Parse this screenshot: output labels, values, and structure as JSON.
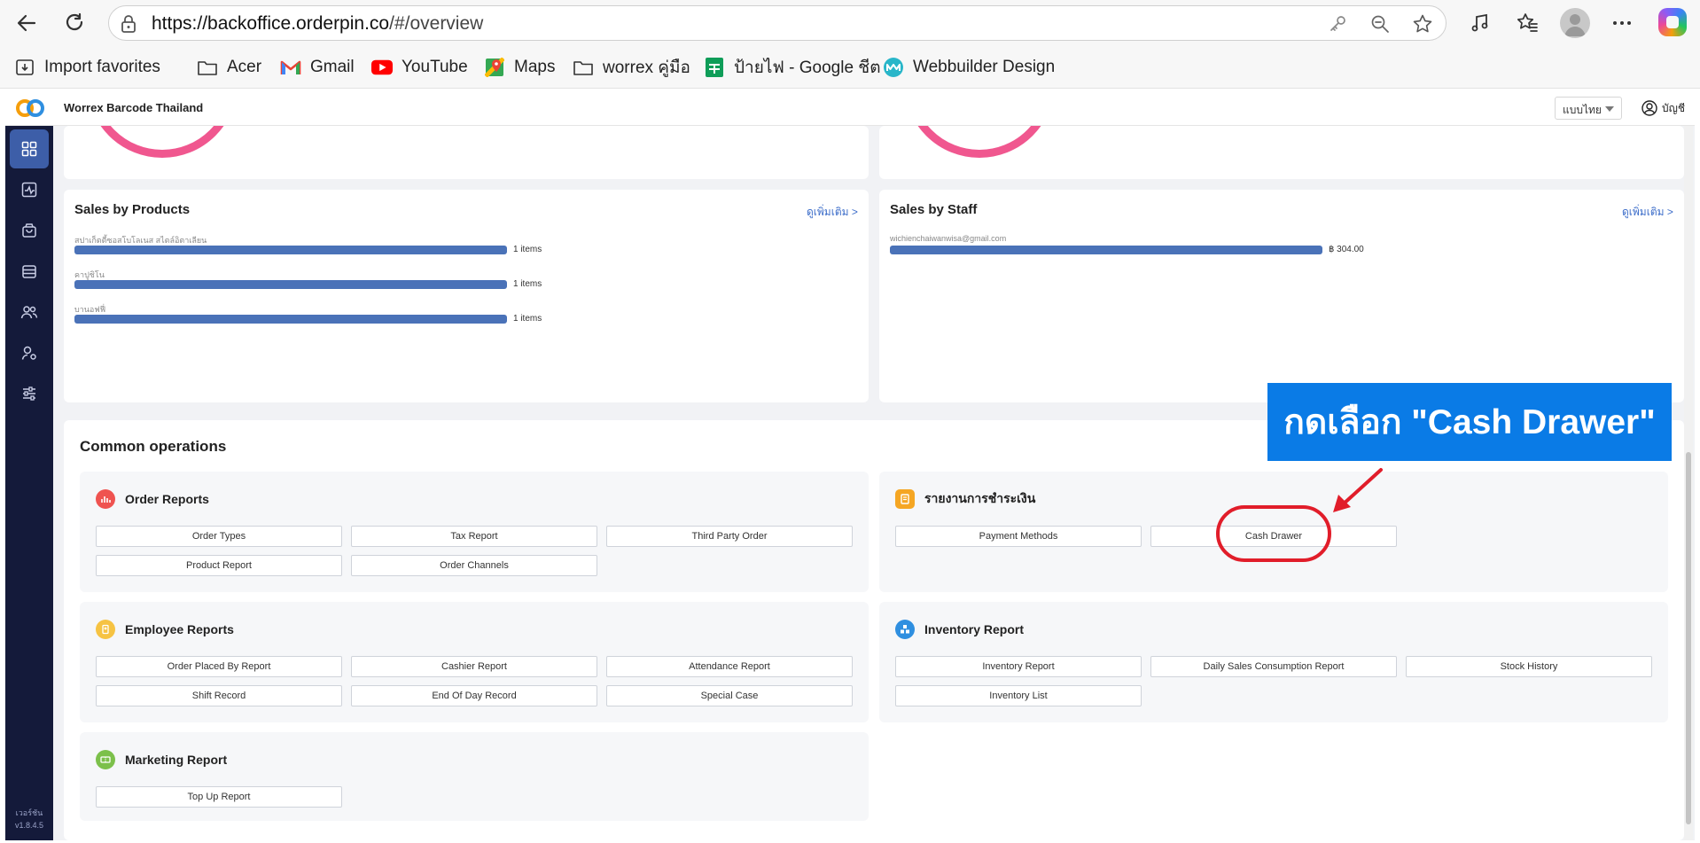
{
  "browser": {
    "url_host": "https://backoffice.orderpin.co",
    "url_path": "/#/overview",
    "favorites": [
      {
        "label": "Import favorites",
        "icon": "import-icon"
      },
      {
        "label": "Acer",
        "icon": "folder-icon"
      },
      {
        "label": "Gmail",
        "icon": "gmail-icon"
      },
      {
        "label": "YouTube",
        "icon": "youtube-icon"
      },
      {
        "label": "Maps",
        "icon": "maps-icon"
      },
      {
        "label": "worrex คู่มือ",
        "icon": "folder-icon"
      },
      {
        "label": "ป้ายไฟ - Google ชีต",
        "icon": "sheets-icon"
      },
      {
        "label": "Webbuilder Design",
        "icon": "webbuilder-icon"
      }
    ]
  },
  "app": {
    "brand": "Worrex Barcode Thailand",
    "language": "แบบไทย",
    "account_label": "บัญชี",
    "version_label": "เวอร์ชัน",
    "version": "v1.8.4.5"
  },
  "sales_by_products": {
    "title": "Sales by Products",
    "more": "ดูเพิ่มเติม >",
    "items": [
      {
        "name": "สปาเก็ตตี้ซอสโบโลเนส สไตล์อิตาเลียน",
        "value": "1 items",
        "fraction": 1.0
      },
      {
        "name": "คาปูชิโน",
        "value": "1 items",
        "fraction": 1.0
      },
      {
        "name": "บานอฟฟี่",
        "value": "1 items",
        "fraction": 1.0
      }
    ]
  },
  "sales_by_staff": {
    "title": "Sales by Staff",
    "more": "ดูเพิ่มเติม >",
    "items": [
      {
        "name": "wichienchaiwanwisa@gmail.com",
        "value": "฿ 304.00",
        "fraction": 1.0
      }
    ]
  },
  "common_operations": {
    "title": "Common operations",
    "order_reports": {
      "title": "Order Reports",
      "buttons": [
        "Order Types",
        "Tax Report",
        "Third Party Order",
        "Product Report",
        "Order Channels"
      ]
    },
    "payment_reports": {
      "title": "รายงานการชำระเงิน",
      "buttons": [
        "Payment Methods",
        "Cash Drawer"
      ]
    },
    "employee_reports": {
      "title": "Employee Reports",
      "buttons": [
        "Order Placed By Report",
        "Cashier Report",
        "Attendance Report",
        "Shift Record",
        "End Of Day Record",
        "Special Case"
      ]
    },
    "inventory_report": {
      "title": "Inventory Report",
      "buttons": [
        "Inventory Report",
        "Daily Sales Consumption Report",
        "Stock History",
        "Inventory List"
      ]
    },
    "marketing_report": {
      "title": "Marketing Report",
      "buttons": [
        "Top Up Report"
      ]
    }
  },
  "annotation": {
    "callout_text": "กดเลือก \"Cash Drawer\""
  },
  "colors": {
    "sidebar": "#141a3a",
    "sidebar_active": "#3d5ea8",
    "bar": "#4a72b8",
    "link": "#3b6cc9",
    "callout": "#0a7be6",
    "highlight": "#e11d2a",
    "donut": "#f0578f"
  }
}
